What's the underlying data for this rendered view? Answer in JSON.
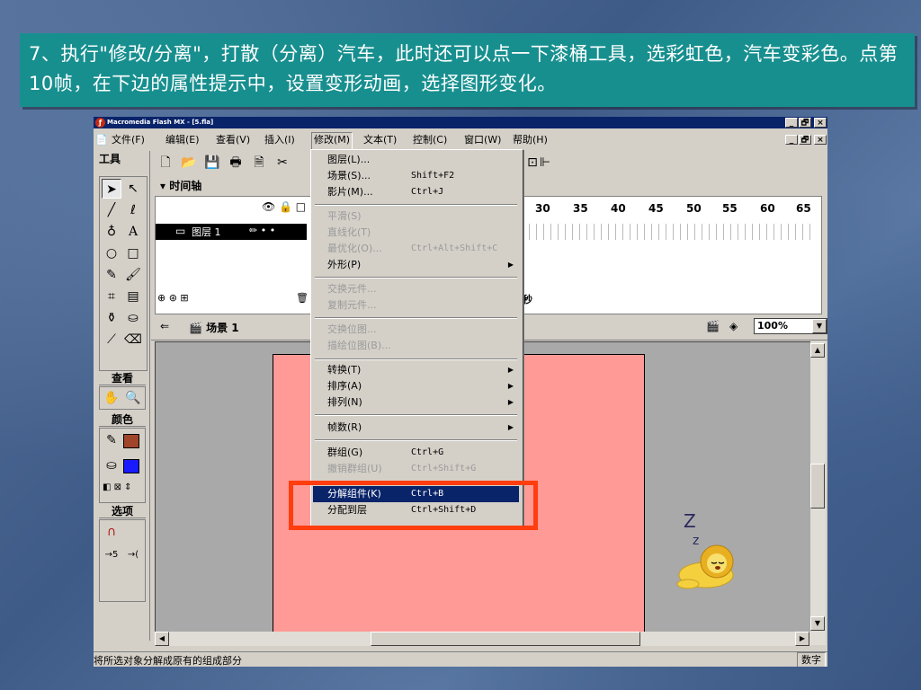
{
  "slide": {
    "instruction": "7、执行\"修改/分离\"，打散（分离）汽车，此时还可以点一下漆桶工具，选彩虹色，汽车变彩色。点第10帧，在下边的属性提示中，设置变形动画，选择图形变化。"
  },
  "window": {
    "title": "Macromedia Flash MX - [5.fla]",
    "controls": [
      "_",
      "🗗",
      "×"
    ]
  },
  "menubar": {
    "items": [
      "文件(F)",
      "编辑(E)",
      "查看(V)",
      "插入(I)",
      "修改(M)",
      "文本(T)",
      "控制(C)",
      "窗口(W)",
      "帮助(H)"
    ],
    "active": "修改(M)"
  },
  "tools": {
    "header": "工具",
    "view_label": "查看",
    "color_label": "颜色",
    "options_label": "选项"
  },
  "timeline": {
    "label": "时间轴",
    "layer_name": "图层 1",
    "frame_numbers": [
      "30",
      "35",
      "40",
      "45",
      "50",
      "55",
      "60",
      "65"
    ],
    "seconds_label": "秒"
  },
  "scene": {
    "label": "场景 1",
    "zoom": "100%"
  },
  "modify_menu": {
    "items": [
      {
        "label": "图层(L)...",
        "shortcut": "",
        "disabled": false,
        "submenu": false
      },
      {
        "label": "场景(S)...",
        "shortcut": "Shift+F2",
        "disabled": false,
        "submenu": false
      },
      {
        "label": "影片(M)...",
        "shortcut": "Ctrl+J",
        "disabled": false,
        "submenu": false
      },
      {
        "label": "平滑(S)",
        "shortcut": "",
        "disabled": true,
        "submenu": false
      },
      {
        "label": "直线化(T)",
        "shortcut": "",
        "disabled": true,
        "submenu": false
      },
      {
        "label": "最优化(O)...",
        "shortcut": "Ctrl+Alt+Shift+C",
        "disabled": true,
        "submenu": false
      },
      {
        "label": "外形(P)",
        "shortcut": "",
        "disabled": false,
        "submenu": true
      },
      {
        "label": "交换元件...",
        "shortcut": "",
        "disabled": true,
        "submenu": false
      },
      {
        "label": "复制元件...",
        "shortcut": "",
        "disabled": true,
        "submenu": false
      },
      {
        "label": "交换位图...",
        "shortcut": "",
        "disabled": true,
        "submenu": false
      },
      {
        "label": "描绘位图(B)...",
        "shortcut": "",
        "disabled": true,
        "submenu": false
      },
      {
        "label": "转换(T)",
        "shortcut": "",
        "disabled": false,
        "submenu": true
      },
      {
        "label": "排序(A)",
        "shortcut": "",
        "disabled": false,
        "submenu": true
      },
      {
        "label": "排列(N)",
        "shortcut": "",
        "disabled": false,
        "submenu": true
      },
      {
        "label": "帧数(R)",
        "shortcut": "",
        "disabled": false,
        "submenu": true
      },
      {
        "label": "群组(G)",
        "shortcut": "Ctrl+G",
        "disabled": false,
        "submenu": false
      },
      {
        "label": "撤销群组(U)",
        "shortcut": "Ctrl+Shift+G",
        "disabled": true,
        "submenu": false
      },
      {
        "label": "分解组件(K)",
        "shortcut": "Ctrl+B",
        "disabled": false,
        "submenu": false,
        "highlighted": true
      },
      {
        "label": "分配到层",
        "shortcut": "Ctrl+Shift+D",
        "disabled": false,
        "submenu": false
      }
    ]
  },
  "stage": {
    "sleep_text_big": "Z",
    "sleep_text_small": "z"
  },
  "statusbar": {
    "text": "将所选对象分解成原有的组成部分",
    "num": "数字"
  },
  "colors": {
    "title_bg": "#188f8f",
    "highlight": "#0a246a",
    "callout": "#ff3d0e",
    "canvas": "#ff9a96",
    "stroke_swatch": "#a0452a",
    "fill_swatch": "#1a1aff"
  }
}
